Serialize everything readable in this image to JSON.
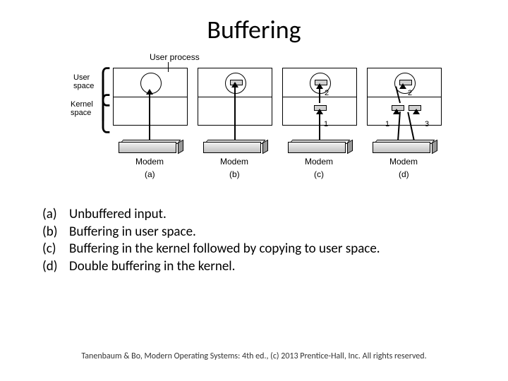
{
  "title": "Buffering",
  "labels": {
    "user_process": "User process",
    "user_space": "User\nspace",
    "kernel_space": "Kernel\nspace",
    "modem": "Modem"
  },
  "panel_letters": [
    "(a)",
    "(b)",
    "(c)",
    "(d)"
  ],
  "numbers": {
    "one": "1",
    "two": "2",
    "three": "3"
  },
  "captions": [
    {
      "key": "(a)",
      "text": "Unbuffered input."
    },
    {
      "key": "(b)",
      "text": "Buffering in user space."
    },
    {
      "key": "(c)",
      "text": "Buffering in the kernel followed by copying to user space."
    },
    {
      "key": "(d)",
      "text": "Double buffering in the kernel."
    }
  ],
  "footer": "Tanenbaum & Bo, Modern Operating Systems: 4th ed., (c) 2013 Prentice-Hall, Inc. All rights reserved."
}
